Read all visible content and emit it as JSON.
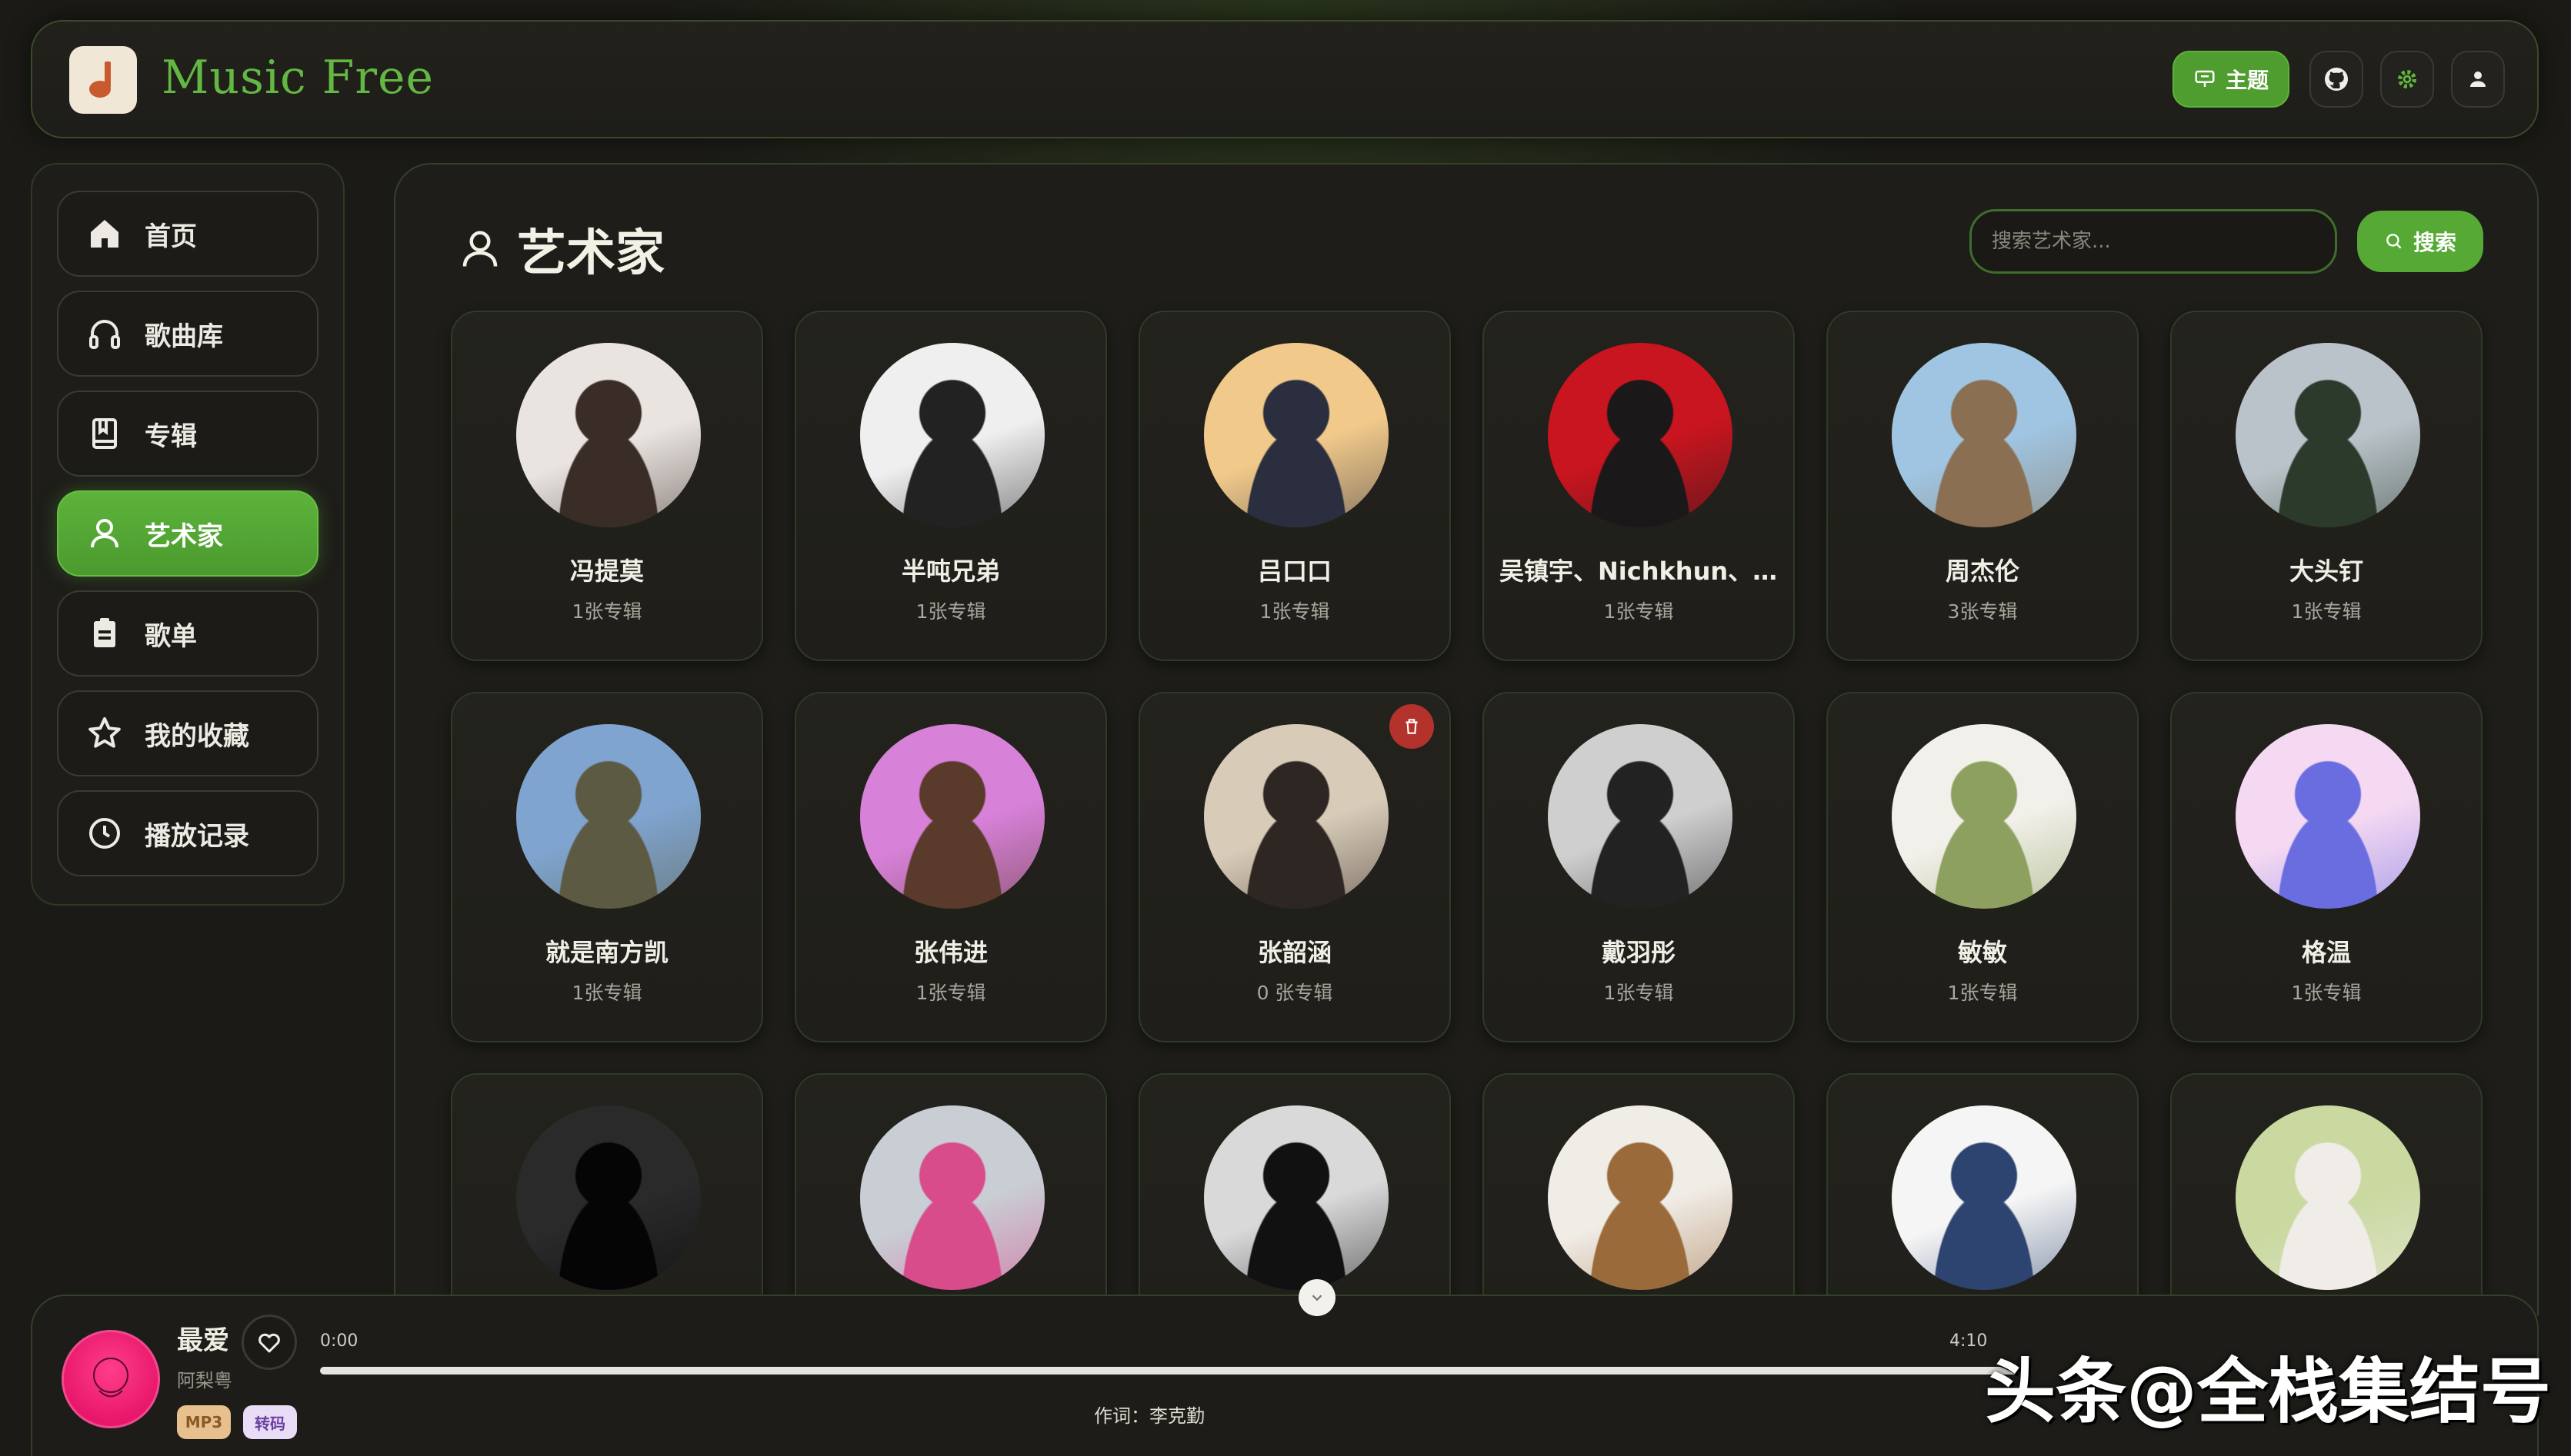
{
  "app": {
    "title": "Music Free"
  },
  "header": {
    "theme_label": "主题",
    "buttons": [
      "github-icon",
      "gear-icon",
      "user-icon"
    ]
  },
  "sidebar": {
    "items": [
      {
        "label": "首页",
        "icon": "home-icon"
      },
      {
        "label": "歌曲库",
        "icon": "headphones-icon"
      },
      {
        "label": "专辑",
        "icon": "book-icon"
      },
      {
        "label": "艺术家",
        "icon": "user-icon",
        "active": true
      },
      {
        "label": "歌单",
        "icon": "clipboard-icon"
      },
      {
        "label": "我的收藏",
        "icon": "star-icon"
      },
      {
        "label": "播放记录",
        "icon": "clock-icon"
      }
    ]
  },
  "main": {
    "title": "艺术家",
    "search_placeholder": "搜索艺术家...",
    "search_label": "搜索",
    "artists": [
      {
        "name": "冯提莫",
        "count": "1张专辑",
        "colors": [
          "#e9e4e0",
          "#3a2d28"
        ]
      },
      {
        "name": "半吨兄弟",
        "count": "1张专辑",
        "colors": [
          "#efefef",
          "#222222"
        ]
      },
      {
        "name": "吕口口",
        "count": "1张专辑",
        "colors": [
          "#f1c98a",
          "#2a2e3e"
        ]
      },
      {
        "name": "吴镇宇、Nichkhun、...",
        "count": "1张专辑",
        "colors": [
          "#c8151f",
          "#1a1818"
        ]
      },
      {
        "name": "周杰伦",
        "count": "3张专辑",
        "colors": [
          "#9fc5e2",
          "#8a6f52"
        ]
      },
      {
        "name": "大头钉",
        "count": "1张专辑",
        "colors": [
          "#b9c3c9",
          "#2c3a2c"
        ]
      },
      {
        "name": "就是南方凯",
        "count": "1张专辑",
        "colors": [
          "#7fa4cf",
          "#5d5a44"
        ]
      },
      {
        "name": "张伟进",
        "count": "1张专辑",
        "colors": [
          "#d781d9",
          "#5a3a2a"
        ]
      },
      {
        "name": "张韶涵",
        "count": "0 张专辑",
        "colors": [
          "#d8cbb8",
          "#2d2622"
        ],
        "deletable": true
      },
      {
        "name": "戴羽彤",
        "count": "1张专辑",
        "colors": [
          "#cfcfcf",
          "#222222"
        ]
      },
      {
        "name": "敏敏",
        "count": "1张专辑",
        "colors": [
          "#f2f0ea",
          "#8ea060"
        ]
      },
      {
        "name": "格温",
        "count": "1张专辑",
        "colors": [
          "#f5d9f2",
          "#6a6de0"
        ]
      },
      {
        "name": "",
        "count": "",
        "colors": [
          "#2a2a2a",
          "#050505"
        ]
      },
      {
        "name": "",
        "count": "",
        "colors": [
          "#c9cdd4",
          "#d84c8c"
        ]
      },
      {
        "name": "",
        "count": "",
        "colors": [
          "#d9d9d9",
          "#111111"
        ]
      },
      {
        "name": "",
        "count": "",
        "colors": [
          "#f0ece6",
          "#9a6a3a"
        ]
      },
      {
        "name": "",
        "count": "",
        "colors": [
          "#f5f5f5",
          "#2d4470"
        ]
      },
      {
        "name": "",
        "count": "",
        "colors": [
          "#c9d9a0",
          "#f0ece8"
        ]
      }
    ]
  },
  "player": {
    "song": "最爱",
    "artist": "阿梨粤",
    "tag_format": "MP3",
    "tag_convert": "转码",
    "time_current": "0:00",
    "time_total": "4:10",
    "lyric": "作词：李克勤",
    "progress": 0
  },
  "watermark": "头条@全栈集结号",
  "colors": {
    "accent": "#55a934",
    "delete": "#b3322c",
    "bg": "#1b1a16"
  }
}
